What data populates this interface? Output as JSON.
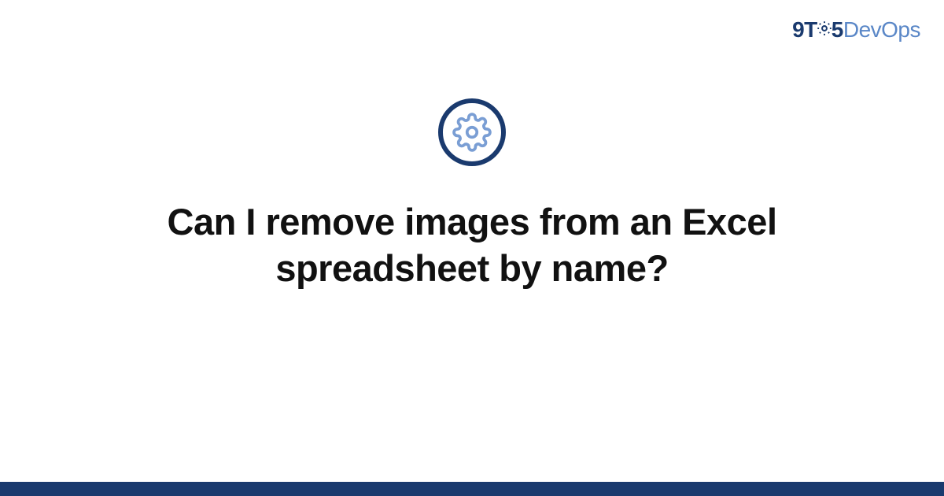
{
  "logo": {
    "part1": "9T",
    "part2": "5",
    "part3": "DevOps"
  },
  "title": "Can I remove images from an Excel spreadsheet by name?",
  "colors": {
    "primary": "#1a3a6e",
    "accent": "#5a87c7"
  }
}
